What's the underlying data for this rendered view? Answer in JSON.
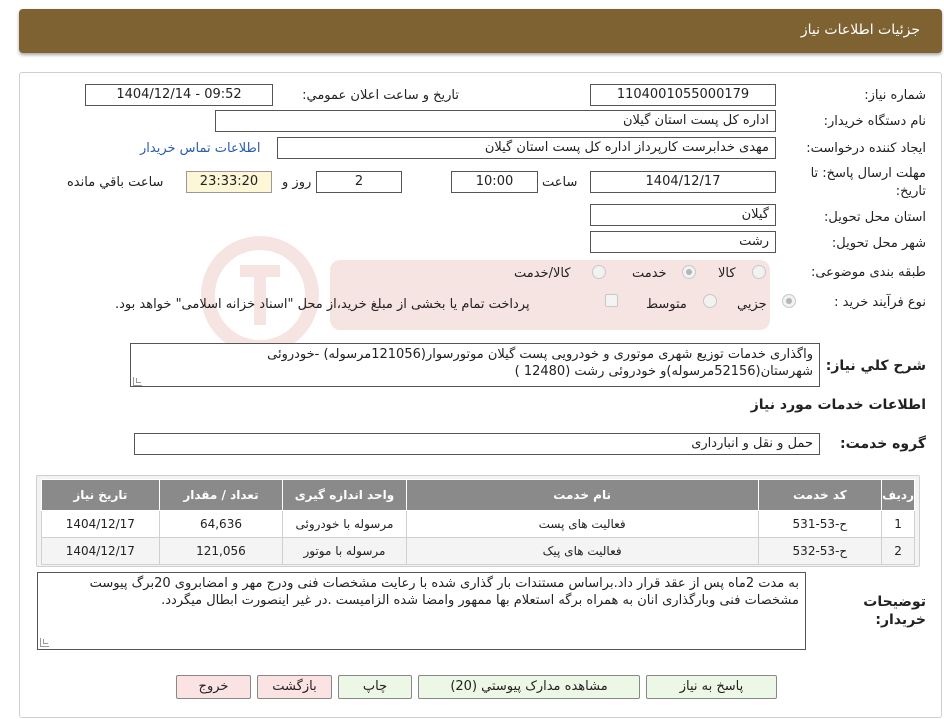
{
  "header": {
    "title": "جزئیات اطلاعات نیاز"
  },
  "fields": {
    "need_number_label": "شماره نیاز:",
    "need_number": "1104001055000179",
    "announce_datetime_label": "تاریخ و ساعت اعلان عمومي:",
    "announce_datetime": "1404/12/14 - 09:52",
    "buyer_org_label": "نام دستگاه خریدار:",
    "buyer_org": "اداره کل پست استان گیلان",
    "requester_label": "ایجاد کننده درخواست:",
    "requester": "مهدی  خدابرست  کارپرداز  اداره کل پست استان گیلان",
    "buyer_contact_link": "اطلاعات تماس خریدار",
    "deadline_label": "مهلت ارسال پاسخ: تا تاریخ:",
    "deadline_date": "1404/12/17",
    "time_label": "ساعت",
    "deadline_time": "10:00",
    "days_value": "2",
    "days_label": "روز و",
    "remaining_time": "23:33:20",
    "remaining_label": "ساعت باقي مانده",
    "province_label": "استان محل تحویل:",
    "province": "گیلان",
    "city_label": "شهر محل تحویل:",
    "city": "رشت",
    "category_label": "طبقه بندی موضوعی:",
    "category_options": [
      "کالا",
      "خدمت",
      "کالا/خدمت"
    ],
    "category_selected": "خدمت",
    "process_label": "نوع فرآیند خرید :",
    "process_options": [
      "جزيي",
      "متوسط"
    ],
    "process_selected": "جزيي",
    "payment_note": "پرداخت تمام یا بخشی از مبلغ خرید،از محل \"اسناد خزانه اسلامی\" خواهد بود."
  },
  "description": {
    "label": "شرح کلي نیاز:",
    "text": "واگذاری خدمات توزیع شهری موتوری و خودرویی پست گیلان  موتورسوار(121056مرسوله) -خودروئی شهرستان(52156مرسوله)و  خودروئی رشت (12480 )"
  },
  "services": {
    "title": "اطلاعات خدمات مورد نیاز",
    "group_label": "گروه خدمت:",
    "group_value": "حمل و نقل و انبارداری",
    "columns": [
      "ردیف",
      "کد خدمت",
      "نام خدمت",
      "واحد اندازه گیری",
      "تعداد / مقدار",
      "تاریخ نیاز"
    ],
    "rows": [
      [
        "1",
        "ح-53-531",
        "فعالیت های پست",
        "مرسوله با خودروئی",
        "64,636",
        "1404/12/17"
      ],
      [
        "2",
        "ح-53-532",
        "فعالیت های پیک",
        "مرسوله با موتور",
        "121,056",
        "1404/12/17"
      ]
    ]
  },
  "buyer_notes": {
    "label": "توضیحات خریدار:",
    "text": "به مدت 2ماه پس از عقد قرار داد.براساس مستندات بار گذاری شده با رعایت مشخصات فنی ودرج مهر و امضابروی 20برگ پیوست مشخصات فنی وبارگذاری انان به همراه برگه استعلام بها  ممهور وامضا شده الزامیست .در غیر اینصورت ابطال میگردد."
  },
  "buttons": {
    "reply": "پاسخ به نیاز",
    "view_docs": "مشاهده مدارک پیوستي (20)",
    "print": "چاپ",
    "back": "بازگشت",
    "exit": "خروج"
  },
  "colors": {
    "header_bg": "#7f6231",
    "table_header_bg": "#8a8a8a",
    "button_green": "#edf7e6",
    "button_pink": "#fbe3e3",
    "link": "#2a5db0",
    "remaining_bg": "#fdf7d7"
  }
}
